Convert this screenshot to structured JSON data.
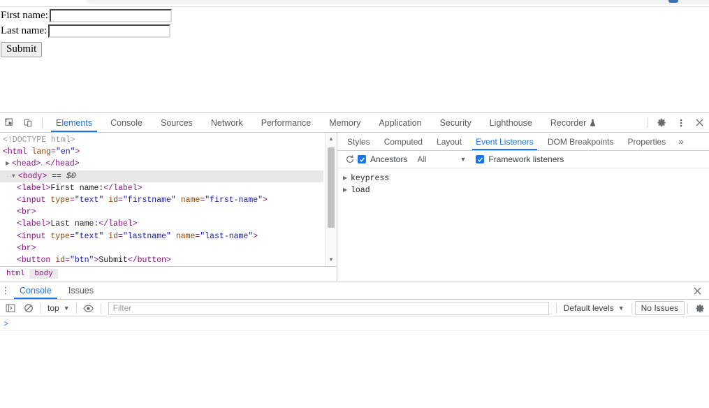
{
  "browser": {
    "omnibox_visible": true,
    "avatar_visible": true
  },
  "page": {
    "first_name_label": "First name:",
    "first_name_value": "",
    "first_name_placeholder": "",
    "last_name_label": "Last name:",
    "last_name_value": "",
    "last_name_placeholder": "",
    "submit_label": "Submit"
  },
  "devtools": {
    "inspect_icon": "inspect-element-icon",
    "device_icon": "device-toolbar-icon",
    "settings_icon": "gear-icon",
    "more_icon": "kebab-menu-icon",
    "close_icon": "close-icon",
    "tabs": [
      {
        "label": "Elements",
        "active": true
      },
      {
        "label": "Console",
        "active": false
      },
      {
        "label": "Sources",
        "active": false
      },
      {
        "label": "Network",
        "active": false
      },
      {
        "label": "Performance",
        "active": false
      },
      {
        "label": "Memory",
        "active": false
      },
      {
        "label": "Application",
        "active": false
      },
      {
        "label": "Security",
        "active": false
      },
      {
        "label": "Lighthouse",
        "active": false
      },
      {
        "label": "Recorder",
        "active": false,
        "experimental": true
      }
    ],
    "dom": {
      "lines": [
        {
          "text": "<!DOCTYPE html>"
        },
        {
          "text": "<html lang=\"en\">"
        },
        {
          "text": "<head>…</head>"
        },
        {
          "text": "<body> == $0"
        },
        {
          "text": "<label>First name:</label>"
        },
        {
          "text": "<input type=\"text\" id=\"firstname\" name=\"first-name\">"
        },
        {
          "text": "<br>"
        },
        {
          "text": "<label>Last name:</label>"
        },
        {
          "text": "<input type=\"text\" id=\"lastname\" name=\"last-name\">"
        },
        {
          "text": "<br>"
        },
        {
          "text": "<button id=\"btn\">Submit</button>"
        }
      ],
      "doctype": "<!DOCTYPE html>",
      "html_tag": "html",
      "html_attr_name": "lang",
      "html_attr_value": "\"en\"",
      "head_tag": "head",
      "body_tag": "body",
      "body_suffix": "== $0",
      "label1_text": "First name:",
      "label2_text": "Last name:",
      "input1_id": "\"firstname\"",
      "input1_name": "\"first-name\"",
      "input2_id": "\"lastname\"",
      "input2_name": "\"last-name\"",
      "input_type_value": "\"text\"",
      "button_id": "\"btn\"",
      "button_text": "Submit"
    },
    "breadcrumb": [
      {
        "label": "html",
        "active": false
      },
      {
        "label": "body",
        "active": true
      }
    ],
    "sidebar": {
      "tabs": [
        {
          "label": "Styles",
          "active": false
        },
        {
          "label": "Computed",
          "active": false
        },
        {
          "label": "Layout",
          "active": false
        },
        {
          "label": "Event Listeners",
          "active": true
        },
        {
          "label": "DOM Breakpoints",
          "active": false
        },
        {
          "label": "Properties",
          "active": false
        }
      ],
      "more_label": "»",
      "toolbar": {
        "refresh_icon": "refresh-icon",
        "ancestors_label": "Ancestors",
        "ancestors_checked": true,
        "filter_value": "All",
        "framework_label": "Framework listeners",
        "framework_checked": true
      },
      "listeners": [
        {
          "name": "keypress",
          "expanded": false
        },
        {
          "name": "load",
          "expanded": false
        }
      ]
    },
    "drawer": {
      "tabs": [
        {
          "label": "Console",
          "active": true
        },
        {
          "label": "Issues",
          "active": false
        }
      ],
      "close_icon": "close-icon",
      "console_toolbar": {
        "sidebar_icon": "console-sidebar-icon",
        "clear_icon": "clear-console-icon",
        "context": "top",
        "eye_icon": "live-expression-eye-icon",
        "filter_placeholder": "Filter",
        "filter_value": "",
        "levels_label": "Default levels",
        "issues_label": "No Issues",
        "settings_icon": "gear-icon"
      },
      "prompt": ">"
    }
  },
  "colors": {
    "accent": "#1a73e8",
    "tag": "#881280",
    "attr_name": "#994500",
    "attr_value": "#1a1aa6",
    "selected_row": "#e8e8e8",
    "prompt": "#3b78e7"
  }
}
